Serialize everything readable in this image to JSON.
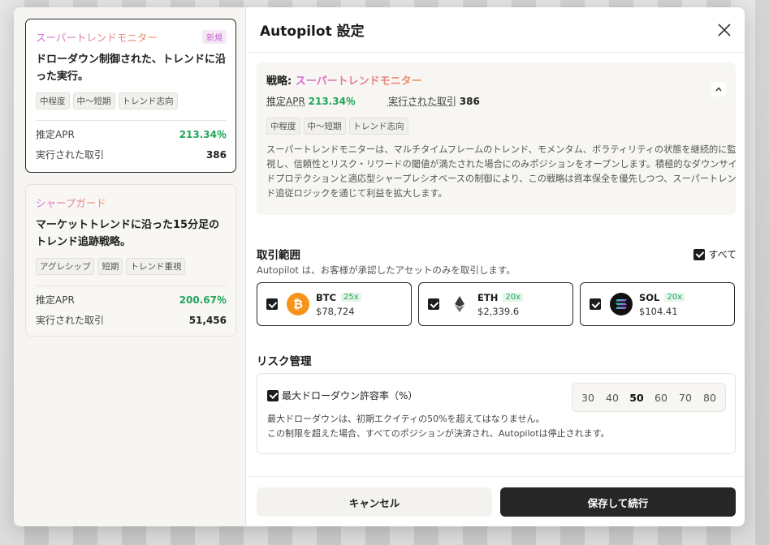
{
  "left": {
    "cards": [
      {
        "name": "スーパートレンドモニター",
        "badge": "新規",
        "desc": "ドローダウン制御された、トレンドに沿った実行。",
        "tags": [
          "中程度",
          "中～短期",
          "トレンド志向"
        ],
        "apr_label": "推定APR",
        "apr": "213.34％",
        "trades_label": "実行された取引",
        "trades": "386"
      },
      {
        "name": "シャープガード",
        "desc": "マーケットトレンドに沿った15分足のトレンド追跡戦略。",
        "tags": [
          "アグレシップ",
          "短期",
          "トレンド重視"
        ],
        "apr_label": "推定APR",
        "apr": "200.67％",
        "trades_label": "実行された取引",
        "trades": "51,456"
      }
    ]
  },
  "header": {
    "title": "Autopilot 設定"
  },
  "strategy": {
    "prefix": "戦略: ",
    "name": "スーパートレンドモニター",
    "apr_label": "推定APR",
    "apr": "213.34％",
    "trades_label": "実行された取引",
    "trades": "386",
    "tags": [
      "中程度",
      "中～短期",
      "トレンド志向"
    ],
    "desc": "スーパートレンドモニターは、マルチタイムフレームのトレンド、モメンタム、ボラティリティの状態を継続的に監視し、信頼性とリスク・リワードの閾値が満たされた場合にのみポジションをオープンします。積極的なダウンサイドプロテクションと適応型シャープレシオベースの制御により、この戦略は資本保全を優先しつつ、スーパートレンド追従ロジックを通じて利益を拡大します。"
  },
  "scope": {
    "title": "取引範囲",
    "subtitle": "Autopilot は、お客様が承認したアセットのみを取引します。",
    "all_label": "すべて",
    "assets": [
      {
        "symbol": "BTC",
        "leverage": "25x",
        "price": "$78,724",
        "color": "#f7931a"
      },
      {
        "symbol": "ETH",
        "leverage": "20x",
        "price": "$2,339.6",
        "color": "#3c3c3d"
      },
      {
        "symbol": "SOL",
        "leverage": "20x",
        "price": "$104.41",
        "color": "#111111"
      }
    ]
  },
  "risk": {
    "title": "リスク管理",
    "label": "最大ドローダウン許容率（%）",
    "options": [
      "30",
      "40",
      "50",
      "60",
      "70",
      "80"
    ],
    "selected": "50",
    "desc1": "最大ドローダウンは、初期エクイティの50%を超えてはなりません。",
    "desc2": "この制限を超えた場合、すべてのポジションが決済され、Autopilotは停止されます。"
  },
  "footer": {
    "cancel": "キャンセル",
    "save": "保存して続行"
  }
}
